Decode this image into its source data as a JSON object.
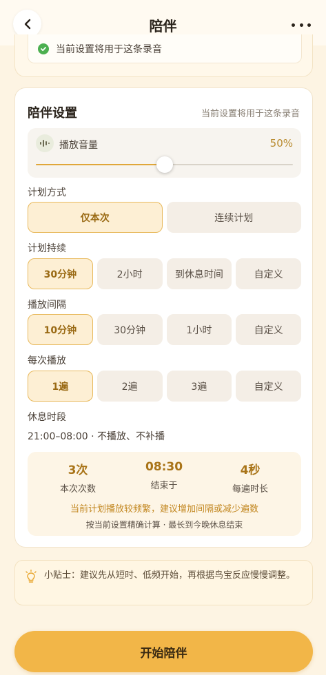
{
  "header": {
    "title": "陪伴"
  },
  "top_notice": {
    "text": "当前设置将用于这条录音"
  },
  "settings": {
    "title": "陪伴设置",
    "subtitle": "当前设置将用于这条录音",
    "volume": {
      "label": "播放音量",
      "value_text": "50%",
      "level_percent": 50
    },
    "plan_mode": {
      "label": "计划方式",
      "options": [
        "仅本次",
        "连续计划"
      ],
      "selected": 0
    },
    "duration": {
      "label": "计划持续",
      "options": [
        "30分钟",
        "2小时",
        "到休息时间",
        "自定义"
      ],
      "selected": 0
    },
    "interval": {
      "label": "播放间隔",
      "options": [
        "10分钟",
        "30分钟",
        "1小时",
        "自定义"
      ],
      "selected": 0
    },
    "repeat": {
      "label": "每次播放",
      "options": [
        "1遍",
        "2遍",
        "3遍",
        "自定义"
      ],
      "selected": 0
    },
    "rest": {
      "label": "休息时段",
      "text": "21:00–08:00 · 不播放、不补播"
    },
    "stats": [
      {
        "value": "3次",
        "label": "本次次数"
      },
      {
        "value": "08:30",
        "label": "结束于"
      },
      {
        "value": "4秒",
        "label": "每遍时长"
      }
    ],
    "warning": "当前计划播放较频繁，建议增加间隔或减少遍数",
    "calc_note": "按当前设置精确计算 · 最长到今晚休息结束"
  },
  "tip": {
    "text": "小贴士：建议先从短时、低频开始，再根据鸟宝反应慢慢调整。"
  },
  "start_button": {
    "label": "开始陪伴"
  },
  "colors": {
    "accent": "#f2b648",
    "selected_border": "#e8b95c",
    "warning": "#c28720",
    "check": "#4caf50"
  }
}
